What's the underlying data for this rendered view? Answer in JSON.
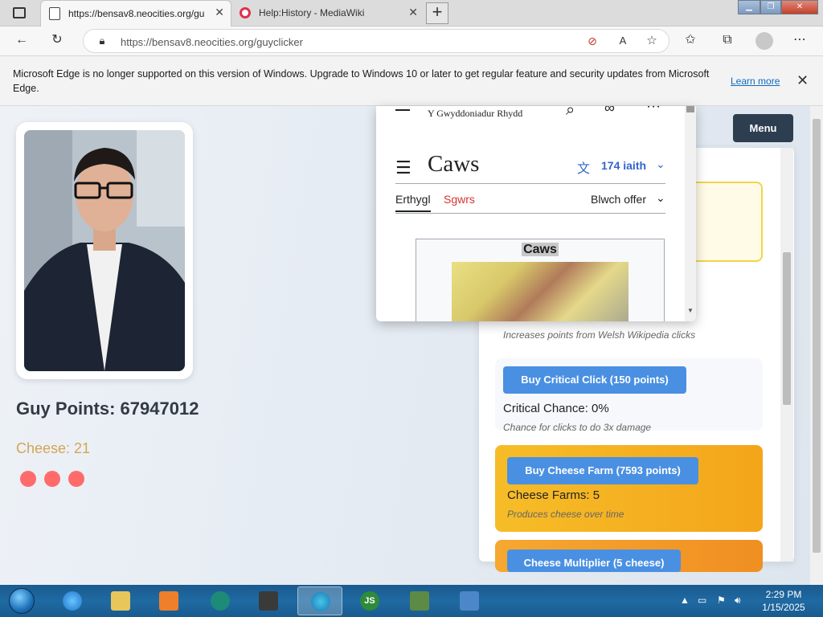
{
  "browser": {
    "tabs": [
      {
        "title": "https://bensav8.neocities.org/gu",
        "active": true
      },
      {
        "title": "Help:History - MediaWiki",
        "active": false
      }
    ],
    "address": "https://bensav8.neocities.org/guyclicker"
  },
  "infobar": {
    "message": "Microsoft Edge is no longer supported on this version of Windows. Upgrade to Windows 10 or later to get regular feature and security updates from Microsoft Edge.",
    "learn_more": "Learn more"
  },
  "game": {
    "points_label": "Guy Points: 67947012",
    "cheese_label": "Cheese: 21",
    "menu": "Menu",
    "desc_partial": "Increases points from Welsh Wikipedia clicks",
    "critical": {
      "button": "Buy Critical Click (150 points)",
      "stat": "Critical Chance: 0%",
      "desc": "Chance for clicks to do 3x damage"
    },
    "farm": {
      "button": "Buy Cheese Farm (7593 points)",
      "stat": "Cheese Farms: 5",
      "desc": "Produces cheese over time"
    },
    "multiplier_button": "Cheese Multiplier (5 cheese)"
  },
  "wiki": {
    "site_name": "Y Gwyddoniadur Rhydd",
    "title": "Caws",
    "languages": "174 iaith",
    "tab_article": "Erthygl",
    "tab_talk": "Sgwrs",
    "tools": "Blwch offer",
    "infobox_caption": "Caws"
  },
  "taskbar": {
    "time": "2:29 PM",
    "date": "1/15/2025"
  },
  "colors": {
    "button_blue": "#4a90e2",
    "menu_dark": "#2c3e50",
    "cheese_text": "#d4a455",
    "accent_link": "#0f6cbd"
  }
}
